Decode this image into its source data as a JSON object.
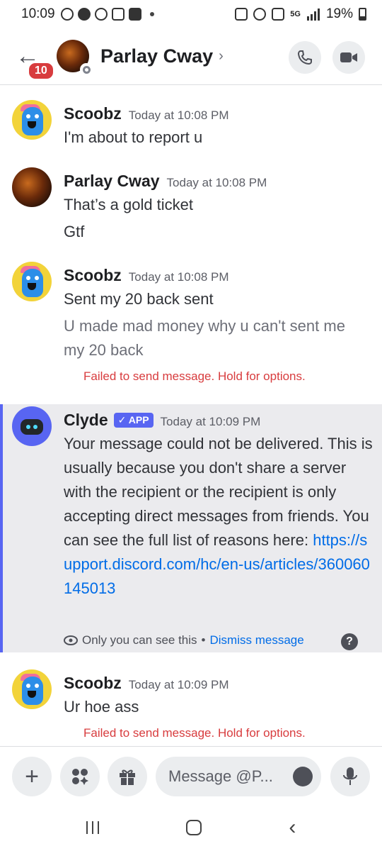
{
  "status_bar": {
    "time": "10:09",
    "battery": "19%",
    "network": "5G"
  },
  "header": {
    "title": "Parlay Cway",
    "unread_badge": "10"
  },
  "messages": [
    {
      "author": "Scoobz",
      "time": "Today at 10:08 PM",
      "lines": [
        "I'm about to report u"
      ]
    },
    {
      "author": "Parlay Cway",
      "time": "Today at 10:08 PM",
      "lines": [
        "That’s a gold ticket",
        "Gtf"
      ]
    },
    {
      "author": "Scoobz",
      "time": "Today at 10:08 PM",
      "lines": [
        "Sent my 20 back sent",
        "U made mad money why u can't sent me my 20 back"
      ],
      "failed": "Failed to send message. Hold for options."
    },
    {
      "author": "Clyde",
      "tag": "APP",
      "time": "Today at 10:09 PM",
      "text": "Your message could not be delivered. This is usually because you don't share a server with the recipient or the recipient is only accepting direct messages from friends. You can see the full list of reasons here:",
      "link": "https://support.discord.com/hc/en-us/articles/360060145013",
      "only_you": "Only you can see this",
      "separator": "•",
      "dismiss": "Dismiss message",
      "help": "?"
    },
    {
      "author": "Scoobz",
      "time": "Today at 10:09 PM",
      "lines": [
        "Ur hoe ass"
      ],
      "failed": "Failed to send message. Hold for options."
    }
  ],
  "composer": {
    "placeholder": "Message @P..."
  },
  "colors": {
    "accent": "#5865f2",
    "error": "#d83c3e",
    "link": "#006ce7"
  }
}
